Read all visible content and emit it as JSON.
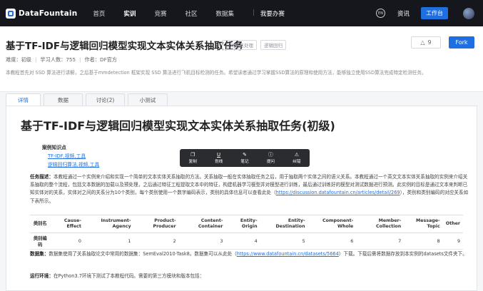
{
  "topbar": {
    "logo_text": "DataFountain",
    "nav": [
      "首页",
      "实训",
      "竞赛",
      "社区",
      "数据集",
      "|",
      "我要办赛"
    ],
    "active_nav": "实训",
    "info_label": "资讯",
    "workbench_label": "工作台"
  },
  "header": {
    "title": "基于TF-IDF与逻辑回归模型实现文本实体关系抽取任务",
    "tags": [
      "自然语言处理",
      "逻辑回归"
    ],
    "like_count": "9",
    "fork_label": "Fork",
    "meta": {
      "difficulty": "难度：初级",
      "learners": "学习人数：755",
      "author": "作者：DF官方"
    },
    "description": "本教程首先对 SSD 算法进行讲解，之后基于mmdetection 框架实现 SSD 算法进行飞机目标检测的任务。希望读者通过学习掌握SSD算法的原理和使用方法，能够独立使用SSD算法完成特定检测任务。"
  },
  "tabs": [
    "详情",
    "数据",
    "讨论(2)",
    "小测试"
  ],
  "content": {
    "title": "基于TF-IDF与逻辑回归模型实现文本实体关系抽取任务(初级)",
    "kb_label": "案例知识点",
    "kb_links": [
      "TF-IDF,视频,工具",
      "逻辑回归算法,视频,工具"
    ],
    "task_label": "任务描述：",
    "task_text_1": "本教程通过一个实例来介绍和实现一个简单的文本实体关系抽取的方法。关系抽取一般在实体抽取任务之后，用于抽取两个实体之间的语义关系。本教程通过一个英文文本实体关系抽取的实例来介绍关系抽取的整个流程，包括文本数据的加载以及预处理，之后通过特征工程提取文本中的特征，构建机器学习模型并对模型进行训练，最后通过训练好的模型对测试数据进行预测。此实例的目标是通过文本来判断已知实体对的关系，实体对之间的关系分为10个类别，每个类别使用一个数字编码表示，类别的具体信息可以查看此处（",
    "task_link": "https://discussion.datafountain.cn/articles/detail/269",
    "task_text_2": "），类别和类别编码的对应关系如下表所示。",
    "table": {
      "headers": [
        "类别名",
        "Cause-Effect",
        "Instrument-Agency",
        "Product-Producer",
        "Content-Container",
        "Entity-Origin",
        "Entity-Destination",
        "Component-Whole",
        "Member-Collection",
        "Message-Topic",
        "Other"
      ],
      "row_label": "类别编码",
      "row_values": [
        "0",
        "1",
        "2",
        "3",
        "4",
        "5",
        "6",
        "7",
        "8",
        "9"
      ]
    },
    "data_label": "数据集：",
    "data_text_1": "数据集使用了关系抽取论文中常用的数据集：SemEval2010-Task8。数据集可以从此处（",
    "data_link": "https://www.datafountain.cn/datasets/5664",
    "data_text_2": "）下载。下载后需将数据存放到本实例的datasets文件夹下。",
    "env_label": "运行环境：",
    "env_text": "在Python3.7环境下测试了本教程代码。需要的第三方模块和版本包括："
  },
  "toolbar": [
    "复制",
    "划线",
    "笔记",
    "提问",
    "纠错"
  ]
}
